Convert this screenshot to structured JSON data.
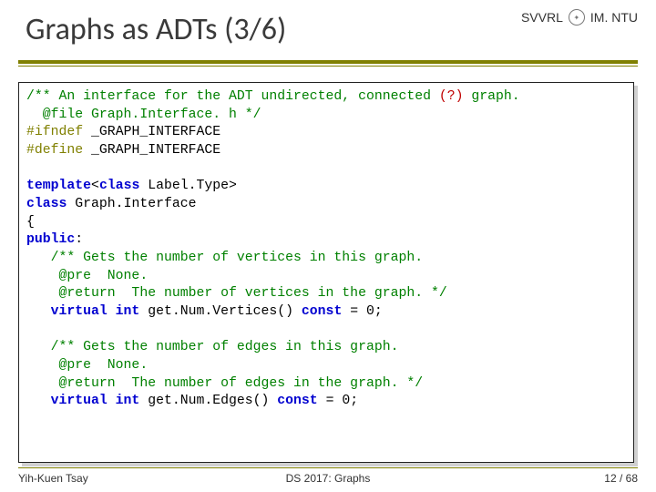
{
  "header": {
    "title": "Graphs as ADTs (3/6)",
    "affil_left": "SVVRL",
    "affil_at": "@",
    "affil_right": "IM. NTU"
  },
  "code": {
    "l01a": "/** An interface for the ADT undirected, connected ",
    "l01b": "(?)",
    "l01c": " graph.",
    "l02": "  @file Graph.Interface. h */",
    "l03a": "#ifndef",
    "l03b": " _GRAPH_INTERFACE",
    "l04a": "#define",
    "l04b": " _GRAPH_INTERFACE",
    "l05": "",
    "l06a": "template",
    "l06b": "<",
    "l06c": "class",
    "l06d": " Label.Type>",
    "l07a": "class",
    "l07b": " Graph.Interface",
    "l08": "{",
    "l09a": "public",
    "l09b": ":",
    "l10": "   /** Gets the number of vertices in this graph.",
    "l11": "    @pre  None.",
    "l12": "    @return  The number of vertices in the graph. */",
    "l13a": "   ",
    "l13b": "virtual int",
    "l13c": " get.Num.Vertices() ",
    "l13d": "const",
    "l13e": " = 0;",
    "l14": "",
    "l15": "   /** Gets the number of edges in this graph.",
    "l16": "    @pre  None.",
    "l17": "    @return  The number of edges in the graph. */",
    "l18a": "   ",
    "l18b": "virtual int",
    "l18c": " get.Num.Edges() ",
    "l18d": "const",
    "l18e": " = 0;"
  },
  "footer": {
    "left": "Yih-Kuen Tsay",
    "center": "DS 2017: Graphs",
    "right": "12 / 68"
  }
}
